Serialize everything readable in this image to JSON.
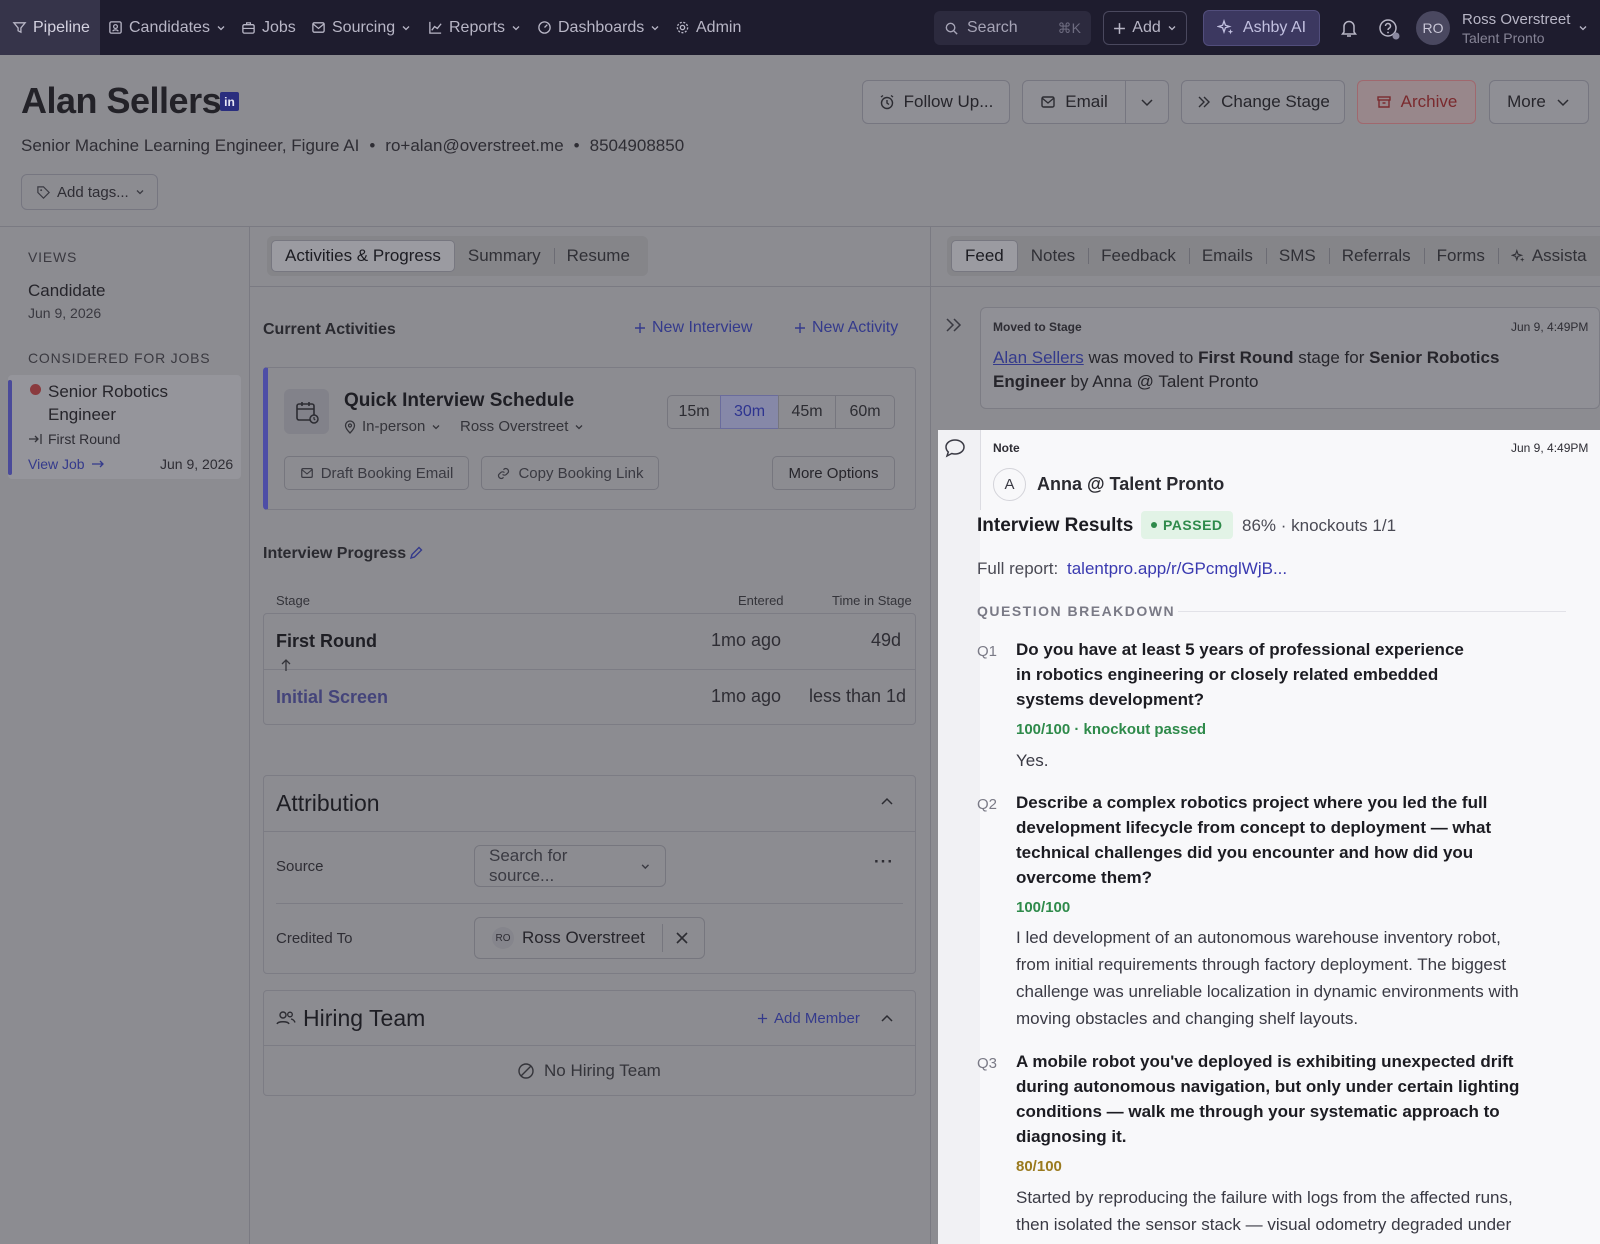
{
  "nav": {
    "items": [
      {
        "label": "Pipeline",
        "icon": "filter-icon"
      },
      {
        "label": "Candidates",
        "icon": "id-card-icon"
      },
      {
        "label": "Jobs",
        "icon": "briefcase-icon"
      },
      {
        "label": "Sourcing",
        "icon": "mail-icon"
      },
      {
        "label": "Reports",
        "icon": "chart-icon"
      },
      {
        "label": "Dashboards",
        "icon": "gauge-icon"
      },
      {
        "label": "Admin",
        "icon": "gear-icon"
      }
    ],
    "search_label": "Search",
    "search_shortcut": "⌘K",
    "add_label": "Add",
    "ai_label": "Ashby AI",
    "user_initials": "RO",
    "user_name": "Ross Overstreet",
    "user_org": "Talent Pronto"
  },
  "candidate": {
    "name": "Alan Sellers",
    "linkedin_badge": "in",
    "title": "Senior Machine Learning Engineer, Figure AI",
    "email": "ro+alan@overstreet.me",
    "phone": "8504908850",
    "add_tags": "Add tags...",
    "bullet": "•"
  },
  "header_buttons": {
    "follow_up": "Follow Up...",
    "email": "Email",
    "change_stage": "Change Stage",
    "archive": "Archive",
    "more": "More"
  },
  "sidebar": {
    "views_heading": "VIEWS",
    "view_name": "Candidate",
    "view_date": "Jun 9, 2026",
    "jobs_heading": "CONSIDERED FOR JOBS",
    "job_title_line1": "Senior Robotics",
    "job_title_line2": "Engineer",
    "job_stage": "First Round",
    "view_job": "View Job",
    "job_date": "Jun 9, 2026"
  },
  "middle_tabs": [
    "Activities & Progress",
    "Summary",
    "Resume"
  ],
  "activities": {
    "heading": "Current Activities",
    "new_interview": "New Interview",
    "new_activity": "New Activity",
    "quick_title": "Quick Interview Schedule",
    "location": "In-person",
    "interviewer": "Ross Overstreet",
    "durations": [
      "15m",
      "30m",
      "45m",
      "60m"
    ],
    "selected_duration": "30m",
    "draft_email": "Draft Booking Email",
    "copy_link": "Copy Booking Link",
    "more_options": "More Options"
  },
  "progress": {
    "heading": "Interview Progress",
    "col_stage": "Stage",
    "col_entered": "Entered",
    "col_time": "Time in Stage",
    "rows": [
      {
        "stage": "First Round",
        "entered": "1mo ago",
        "time": "49d"
      },
      {
        "stage": "Initial Screen",
        "entered": "1mo ago",
        "time": "less than 1d"
      }
    ]
  },
  "attribution": {
    "heading": "Attribution",
    "source_label": "Source",
    "source_placeholder": "Search for source...",
    "credited_label": "Credited To",
    "credited_initials": "RO",
    "credited_name": "Ross Overstreet",
    "menu": "···"
  },
  "hiring_team": {
    "heading": "Hiring Team",
    "add_member": "Add Member",
    "empty": "No Hiring Team"
  },
  "feed_tabs": [
    "Feed",
    "Notes",
    "Feedback",
    "Emails",
    "SMS",
    "Referrals",
    "Forms",
    "Assista"
  ],
  "feed": {
    "moved_label": "Moved to Stage",
    "moved_time": "Jun 9, 4:49PM",
    "moved_name": "Alan Sellers",
    "moved_text1": "was moved to",
    "moved_stage": "First Round",
    "moved_text2": "stage for",
    "moved_job1": "Senior Robotics",
    "moved_job2": "Engineer",
    "moved_by": "by Anna @ Talent Pronto"
  },
  "note": {
    "label": "Note",
    "time": "Jun 9, 4:49PM",
    "author_initial": "A",
    "author": "Anna @ Talent Pronto",
    "results_title": "Interview Results",
    "status": "PASSED",
    "summary": "86% · knockouts 1/1",
    "report_label": "Full report:",
    "report_link": "talentpro.app/r/GPcmglWjB...",
    "breakdown_heading": "QUESTION BREAKDOWN",
    "questions": [
      {
        "num": "Q1",
        "lines": [
          "Do you have at least 5 years of professional experience",
          "in robotics engineering or closely related embedded",
          "systems development?"
        ],
        "score": "100/100 · knockout passed",
        "answer": [
          "Yes."
        ]
      },
      {
        "num": "Q2",
        "lines": [
          "Describe a complex robotics project where you led the full",
          "development lifecycle from concept to deployment — what",
          "technical challenges did you encounter and how did you",
          "overcome them?"
        ],
        "score": "100/100",
        "answer": [
          "I led development of an autonomous warehouse inventory robot,",
          "from initial requirements through factory deployment. The biggest",
          "challenge was unreliable localization in dynamic environments with",
          "moving obstacles and changing shelf layouts."
        ]
      },
      {
        "num": "Q3",
        "lines": [
          "A mobile robot you've deployed is exhibiting unexpected drift",
          "during autonomous navigation, but only under certain lighting",
          "conditions — walk me through your systematic approach to",
          "diagnosing it."
        ],
        "score": "80/100",
        "answer": [
          "Started by reproducing the failure with logs from the affected runs,",
          "then isolated the sensor stack — visual odometry degraded under"
        ]
      }
    ]
  },
  "colors": {
    "nav_bg": "#1e1c2e",
    "accent": "#4e4ea6",
    "passed_green": "#2e8a4a",
    "score_amber": "#9a7a1e",
    "link_blue": "#3a3ab0"
  }
}
